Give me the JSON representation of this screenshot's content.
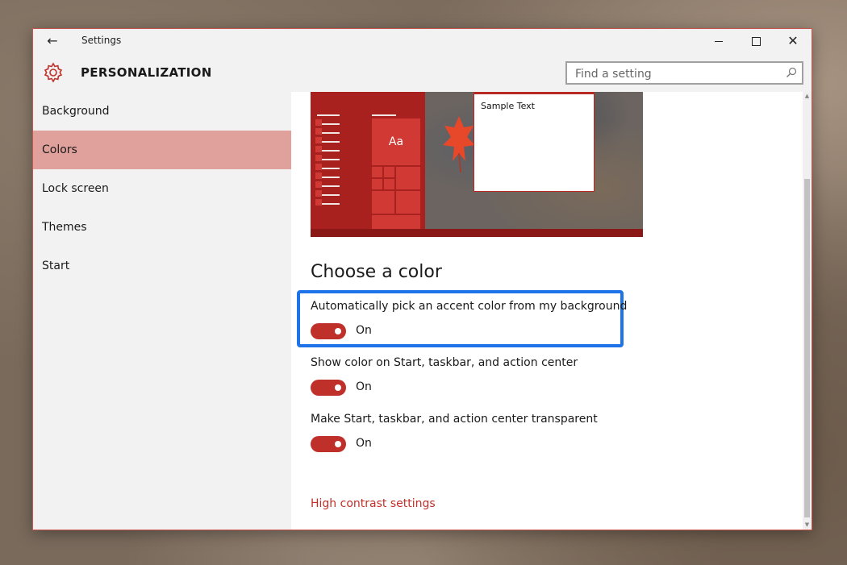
{
  "window": {
    "title": "Settings",
    "back_icon": "arrow-left-icon",
    "accent_color": "#c0302a"
  },
  "header": {
    "title": "PERSONALIZATION",
    "icon": "gear-icon",
    "search": {
      "placeholder": "Find a setting"
    }
  },
  "sidebar": {
    "items": [
      {
        "label": "Background",
        "active": false
      },
      {
        "label": "Colors",
        "active": true
      },
      {
        "label": "Lock screen",
        "active": false
      },
      {
        "label": "Themes",
        "active": false
      },
      {
        "label": "Start",
        "active": false
      }
    ]
  },
  "preview": {
    "tile_label": "Aa",
    "sample_text": "Sample Text"
  },
  "main": {
    "section_title": "Choose a color",
    "options": [
      {
        "label": "Automatically pick an accent color from my background",
        "state": "On",
        "highlighted": true
      },
      {
        "label": "Show color on Start, taskbar, and action center",
        "state": "On",
        "highlighted": false
      },
      {
        "label": "Make Start, taskbar, and action center transparent",
        "state": "On",
        "highlighted": false
      }
    ],
    "link": "High contrast settings"
  }
}
